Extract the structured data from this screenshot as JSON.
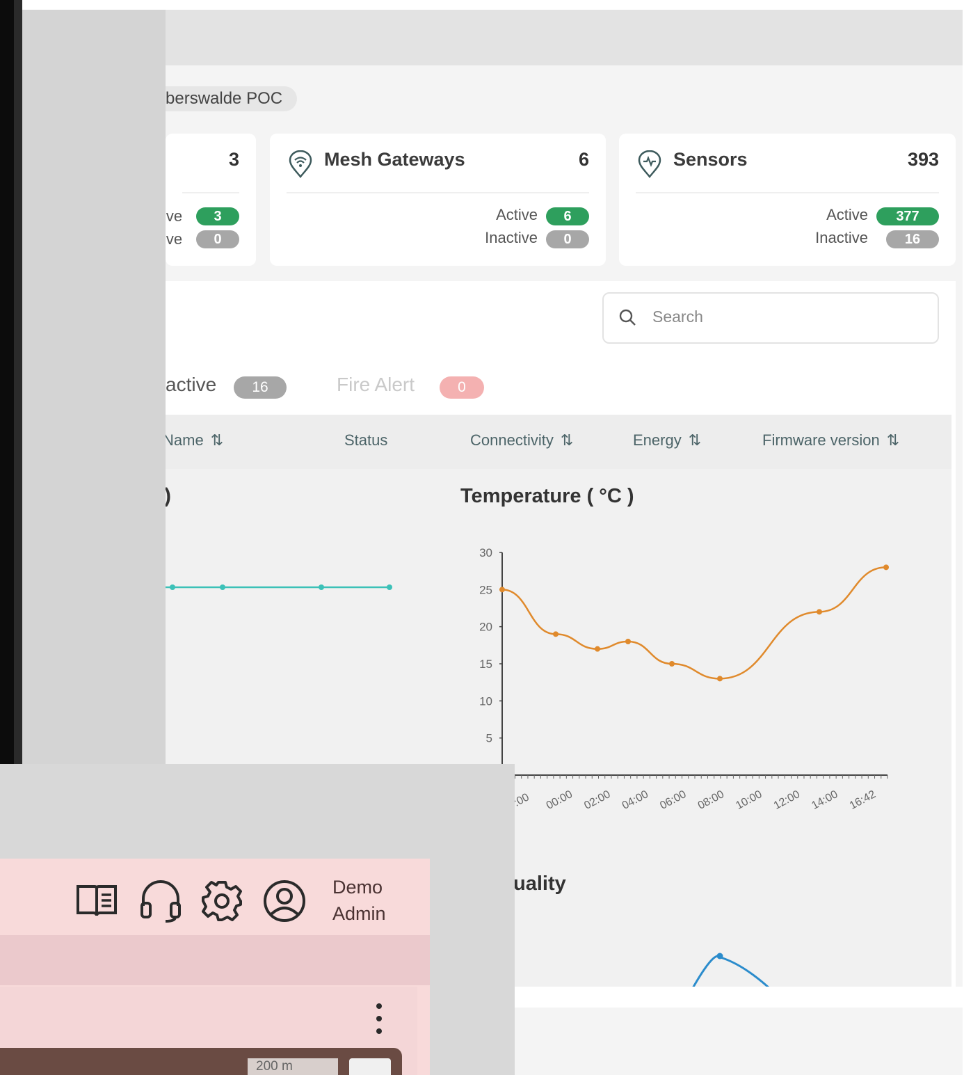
{
  "breadcrumb": {
    "project": "berswalde POC"
  },
  "cards": {
    "card1": {
      "count": "3",
      "active_label": "ive",
      "active_count": "3",
      "inactive_label": "ive",
      "inactive_count": "0"
    },
    "mesh_gateways": {
      "title": "Mesh Gateways",
      "count": "6",
      "active_label": "Active",
      "active_count": "6",
      "inactive_label": "Inactive",
      "inactive_count": "0",
      "icon": "wifi-pin-icon"
    },
    "sensors": {
      "title": "Sensors",
      "count": "393",
      "active_label": "Active",
      "active_count": "377",
      "inactive_label": "Inactive",
      "inactive_count": "16",
      "icon": "heartbeat-pin-icon"
    }
  },
  "search": {
    "placeholder": "Search"
  },
  "tabs": {
    "inactive": {
      "label": "active",
      "count": "16"
    },
    "fire_alert": {
      "label": "Fire Alert",
      "count": "0"
    }
  },
  "table": {
    "columns": {
      "name": "Name",
      "status": "Status",
      "connectivity": "Connectivity",
      "energy": "Energy",
      "firmware": "Firmware version"
    },
    "sort_glyph": "⇅"
  },
  "charts": {
    "left_title_fragment": ")",
    "temperature_title": "Temperature ( °C )",
    "bottom_title_fragment": "uality"
  },
  "chart_data": [
    {
      "type": "line",
      "title": "Temperature ( °C )",
      "xlabel": "",
      "ylabel": "",
      "x": [
        "00:00",
        "02:00",
        "04:00",
        "06:00",
        "08:00",
        "10:00",
        "12:00",
        "14:00",
        "16:42"
      ],
      "x_visible_partial_first": ":00",
      "series": [
        {
          "points": [
            [
              ":00",
              25
            ],
            [
              "02:00",
              19
            ],
            [
              "04:00",
              17
            ],
            [
              "05:30",
              18
            ],
            [
              "08:00",
              15
            ],
            [
              "10:00",
              13
            ],
            [
              "14:00",
              22
            ],
            [
              "16:42",
              28
            ]
          ],
          "color": "#e08a2c"
        }
      ],
      "yticks": [
        "5",
        "10",
        "15",
        "20",
        "25",
        "30"
      ],
      "ylim": [
        0,
        30
      ],
      "grid": false
    },
    {
      "type": "line",
      "title": "",
      "series": [
        {
          "values": [
            25,
            25,
            25,
            25
          ],
          "color": "#3cc1b8"
        }
      ]
    }
  ],
  "foreground": {
    "user": {
      "line1": "Demo",
      "line2": "Admin"
    },
    "icons": [
      "book-icon",
      "headset-icon",
      "gear-icon",
      "user-circle-icon"
    ],
    "map": {
      "scale": "200 m",
      "zoom": "+"
    }
  },
  "colors": {
    "active_green": "#2e9f5d",
    "inactive_gray": "#a7a7a7",
    "temp_line": "#e08a2c",
    "teal_line": "#3cc1b8"
  }
}
